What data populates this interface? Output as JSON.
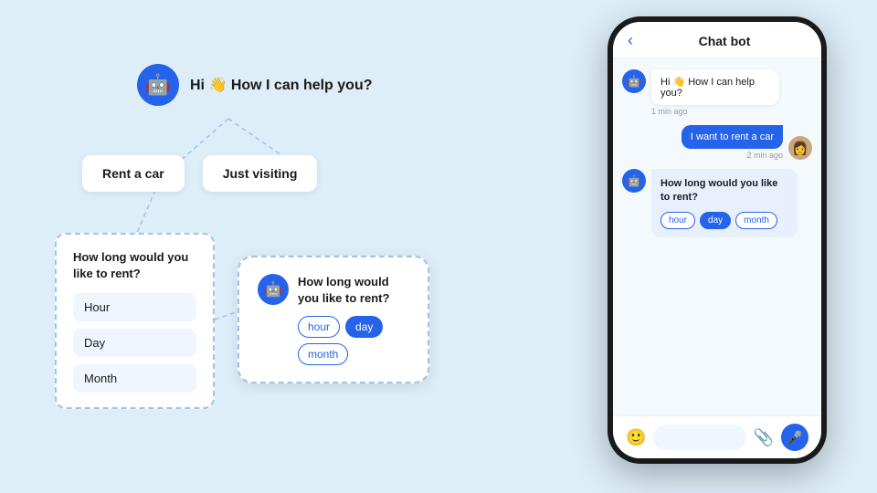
{
  "colors": {
    "bg": "#deeef8",
    "blue": "#2563eb",
    "white": "#ffffff",
    "dark": "#1a1a1a"
  },
  "greeting": {
    "emoji": "👋",
    "text": "Hi 👋 How I can help you?"
  },
  "options": {
    "rent": "Rent a car",
    "visit": "Just visiting"
  },
  "rent_card": {
    "title": "How long would you like to rent?",
    "items": [
      "Hour",
      "Day",
      "Month"
    ]
  },
  "float_card": {
    "title": "How long would you like to rent?",
    "options": [
      "hour",
      "day",
      "month"
    ],
    "active": "day"
  },
  "phone": {
    "header": {
      "back": "‹",
      "title": "Chat bot"
    },
    "messages": [
      {
        "type": "bot",
        "text": "Hi 👋 How I can help you?",
        "time": "1 min ago"
      },
      {
        "type": "user",
        "text": "I want to rent a car",
        "time": "2 min ago"
      }
    ],
    "bot_card": {
      "title": "How long would you like to rent?",
      "options": [
        "hour",
        "day",
        "month"
      ],
      "active": "day"
    },
    "footer": {
      "emoji": "🙂",
      "clip": "📎",
      "mic": "🎤"
    }
  }
}
